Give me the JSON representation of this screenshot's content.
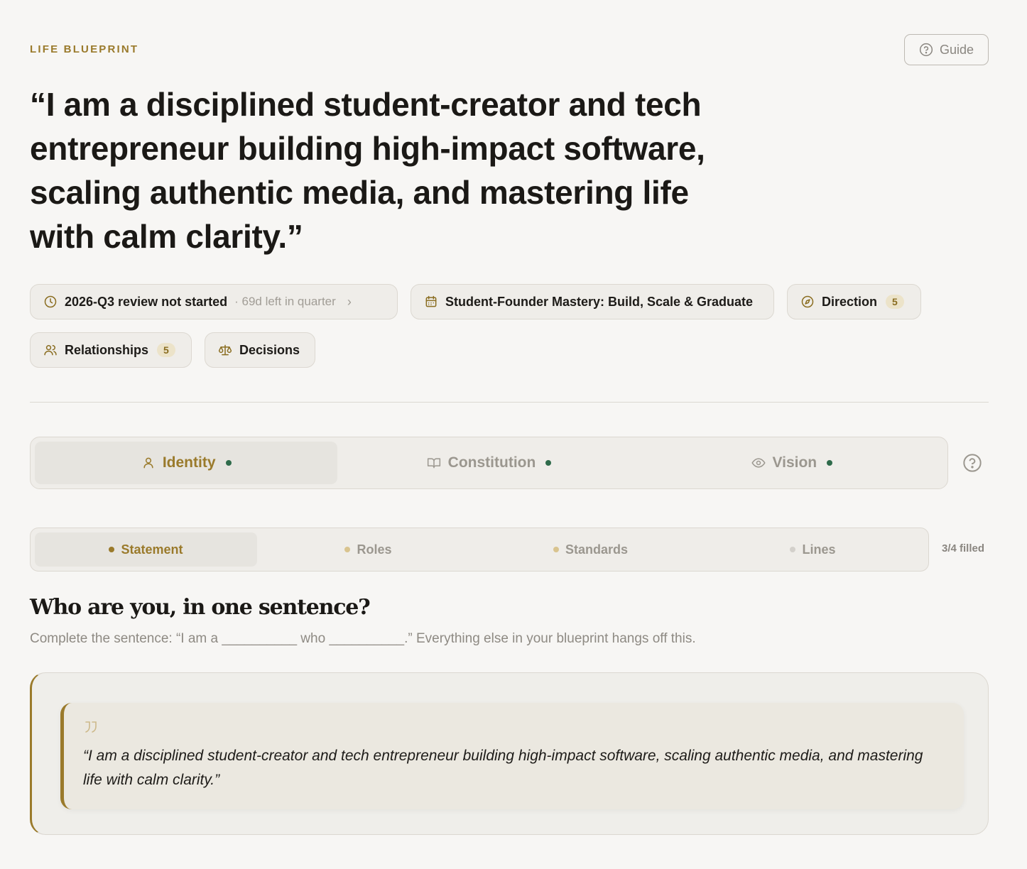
{
  "header": {
    "eyebrow": "LIFE BLUEPRINT",
    "guide_label": "Guide",
    "statement": "“I am a disciplined student-creator and tech entrepreneur building high-impact software, scaling authentic media, and mastering life with calm clarity.”"
  },
  "chips": {
    "review": {
      "label": "2026-Q3 review not started",
      "detail": "· 69d left in quarter",
      "icon": "clock-icon"
    },
    "goal": {
      "label": "Student-Founder Mastery: Build, Scale & Graduate",
      "icon": "calendar-icon"
    },
    "direction": {
      "label": "Direction",
      "count": "5",
      "icon": "compass-icon"
    },
    "relationships": {
      "label": "Relationships",
      "count": "5",
      "icon": "users-icon"
    },
    "decisions": {
      "label": "Decisions",
      "icon": "scale-icon"
    }
  },
  "tabs": [
    {
      "label": "Identity",
      "icon": "user-icon",
      "active": true
    },
    {
      "label": "Constitution",
      "icon": "book-icon",
      "active": false
    },
    {
      "label": "Vision",
      "icon": "eye-icon",
      "active": false
    }
  ],
  "subtabs": [
    {
      "label": "Statement",
      "dot_color": "#9a7a2b"
    },
    {
      "label": "Roles",
      "dot_color": "#d9c48f"
    },
    {
      "label": "Standards",
      "dot_color": "#d9c48f"
    },
    {
      "label": "Lines",
      "dot_color": "#d3d0cb"
    }
  ],
  "progress": {
    "filled_label": "3/4 filled"
  },
  "question": {
    "title": "Who are you, in one sentence?",
    "description": "Complete the sentence: “I am a __________ who __________.” Everything else in your blueprint hangs off this.",
    "answer": "“I am a disciplined student-creator and tech entrepreneur building high-impact software, scaling authentic media, and mastering life with calm clarity.”"
  },
  "colors": {
    "accent": "#9a7a2b",
    "status_green": "#2f6b4b",
    "background": "#f7f6f4"
  }
}
